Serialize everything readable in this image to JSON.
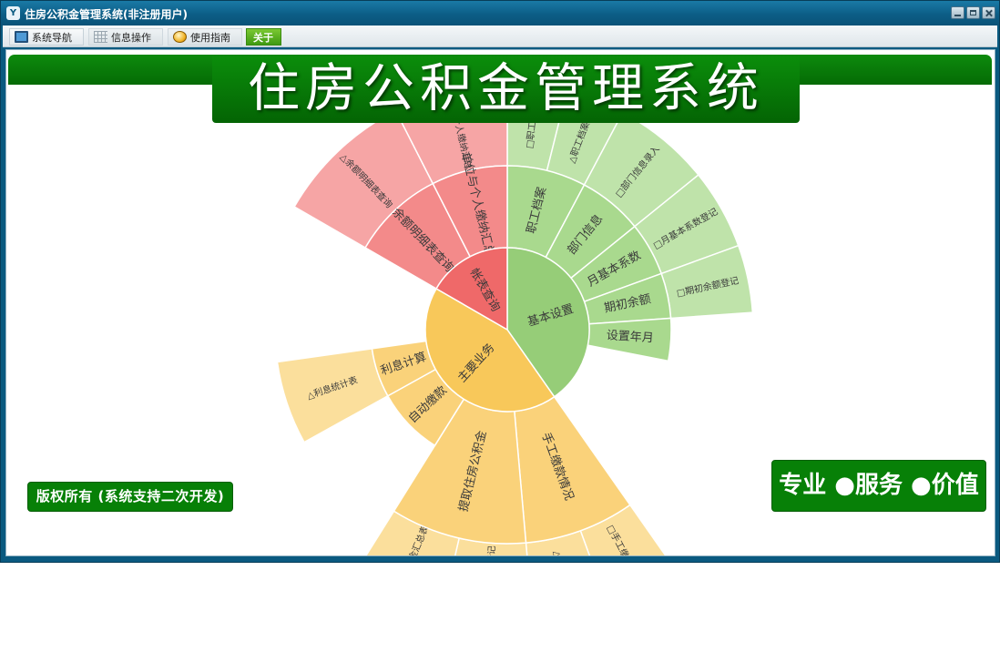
{
  "window": {
    "title": "住房公积金管理系统(非注册用户)",
    "app_icon_glyph": "Y"
  },
  "menu": [
    {
      "label": "系统导航",
      "icon": "monitor-icon"
    },
    {
      "label": "信息操作",
      "icon": "grid-icon"
    },
    {
      "label": "使用指南",
      "icon": "help-icon"
    },
    {
      "label": "关于",
      "icon": ""
    }
  ],
  "banner": {
    "title": "住房公积金管理系统"
  },
  "footer": {
    "copyright": "版权所有 (系统支持二次开发)",
    "slogan": "专业 ●服务 ●价值"
  },
  "colors": {
    "brand_green": "#078007",
    "window_blue": "#0a5a80",
    "sector_green_inner": "#96cd78",
    "sector_green_mid": "#a9d98e",
    "sector_green_outer": "#bfe3aa",
    "sector_yellow_inner": "#f8c85a",
    "sector_yellow_mid": "#fad27a",
    "sector_yellow_outer": "#fbdf9c",
    "sector_red_inner": "#ef6969",
    "sector_red_mid": "#f38a8a",
    "sector_red_outer": "#f6a5a5"
  },
  "sunburst": {
    "nodes": [
      {
        "label": "基本设置",
        "color": "green",
        "children": [
          {
            "label": "职工档案",
            "children": [
              {
                "label": "□职工档..."
              },
              {
                "label": "△职工档案..."
              }
            ]
          },
          {
            "label": "部门信息",
            "children": [
              {
                "label": "□部门信息录入"
              }
            ]
          },
          {
            "label": "月基本系数",
            "children": [
              {
                "label": "□月基本系数登记"
              }
            ]
          },
          {
            "label": "期初余额",
            "children": [
              {
                "label": "□期初余额登记"
              }
            ]
          },
          {
            "label": "设置年月",
            "children": []
          }
        ]
      },
      {
        "label": "主要业务",
        "color": "yellow",
        "children": [
          {
            "label": "手工缴款情况",
            "children": [
              {
                "label": "□手工缴款登记"
              },
              {
                "label": "△手工缴存..."
              }
            ]
          },
          {
            "label": "提取住房公积金",
            "children": [
              {
                "label": "□提取公积金登记"
              },
              {
                "label": "△提取公积金汇总表"
              }
            ]
          },
          {
            "label": "自动缴款",
            "children": []
          },
          {
            "label": "利息计算",
            "children": [
              {
                "label": "△利息统计表"
              }
            ]
          }
        ]
      },
      {
        "label": "帐表查询",
        "color": "red",
        "children": [
          {
            "label": "余额明细表查询",
            "children": [
              {
                "label": "△余额明细表查询"
              }
            ]
          },
          {
            "label": "单位与个人缴纳汇总表",
            "children": [
              {
                "label": "△单位与个人缴纳汇总表"
              }
            ]
          }
        ]
      }
    ]
  }
}
